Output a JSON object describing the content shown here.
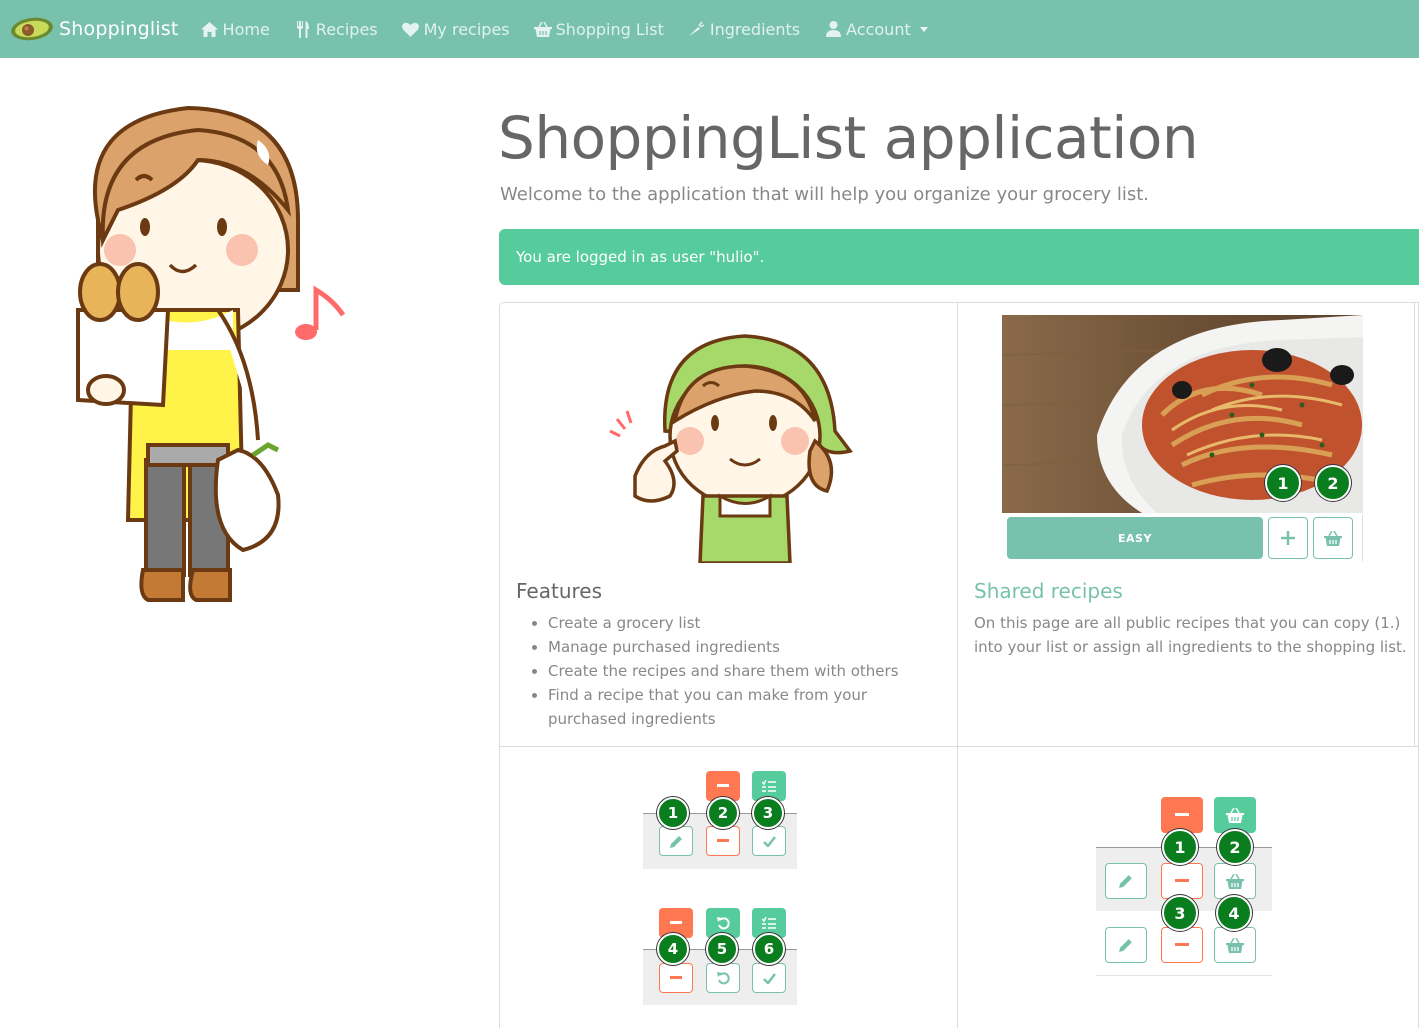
{
  "navbar": {
    "brand": "Shoppinglist",
    "items": [
      {
        "label": "Home",
        "icon": "home-icon"
      },
      {
        "label": "Recipes",
        "icon": "cutlery-icon"
      },
      {
        "label": "My recipes",
        "icon": "heart-icon"
      },
      {
        "label": "Shopping List",
        "icon": "basket-icon"
      },
      {
        "label": "Ingredients",
        "icon": "carrot-icon"
      },
      {
        "label": "Account",
        "icon": "user-icon"
      }
    ]
  },
  "header": {
    "title": "ShoppingList application",
    "lead": "Welcome to the application that will help you organize your grocery list.",
    "alert": "You are logged in as user \"hulio\"."
  },
  "features": {
    "title": "Features",
    "items": [
      "Create a grocery list",
      "Manage purchased ingredients",
      "Create the recipes and share them with others",
      "Find a recipe that you can make from your purchased ingredients"
    ]
  },
  "shared": {
    "title": "Shared recipes",
    "text": "On this page are all public recipes that you can copy (1.) into your list or assign all ingredients to the shopping list.",
    "difficulty": "EASY",
    "markers": [
      "1",
      "2"
    ]
  },
  "shopping_demo": {
    "markers": [
      "1",
      "2",
      "3",
      "4",
      "5",
      "6"
    ]
  },
  "ingredients_demo": {
    "markers": [
      "1",
      "2",
      "3",
      "4"
    ]
  },
  "colors": {
    "primary": "#78c2ad",
    "success": "#56cc9d",
    "danger": "#ff7851",
    "marker": "#0a7d1e"
  }
}
